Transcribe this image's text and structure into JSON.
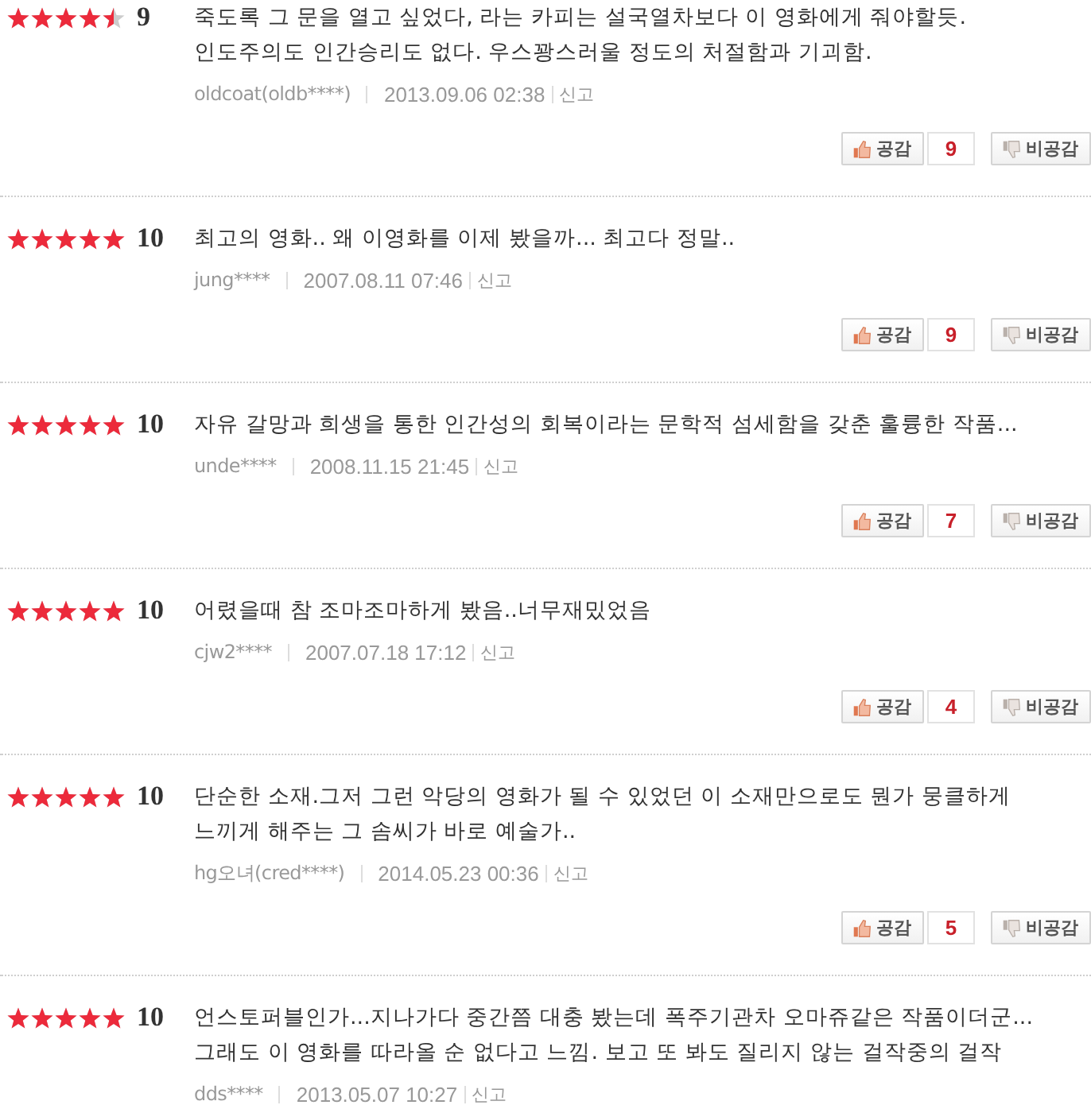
{
  "reviews": [
    {
      "stars": 4.5,
      "score": "9",
      "text": "죽도록 그 문을 열고 싶었다, 라는 카피는 설국열차보다 이 영화에게 줘야할듯. 인도주의도 인간승리도 없다. 우스꽝스러울 정도의 처절함과 기괴함.",
      "user": "oldcoat(oldb****)",
      "date": "2013.09.06 02:38",
      "report": "신고",
      "like_label": "공감",
      "like_count": "9",
      "dislike_label": "비공감"
    },
    {
      "stars": 5,
      "score": "10",
      "text": "최고의 영화.. 왜 이영화를 이제 봤을까... 최고다 정말..",
      "user": "jung****",
      "date": "2007.08.11 07:46",
      "report": "신고",
      "like_label": "공감",
      "like_count": "9",
      "dislike_label": "비공감"
    },
    {
      "stars": 5,
      "score": "10",
      "text": "자유 갈망과 희생을 통한 인간성의 회복이라는 문학적 섬세함을 갖춘 훌륭한 작품...",
      "user": "unde****",
      "date": "2008.11.15 21:45",
      "report": "신고",
      "like_label": "공감",
      "like_count": "7",
      "dislike_label": "비공감"
    },
    {
      "stars": 5,
      "score": "10",
      "text": "어렸을때 참 조마조마하게 봤음..너무재밌었음",
      "user": "cjw2****",
      "date": "2007.07.18 17:12",
      "report": "신고",
      "like_label": "공감",
      "like_count": "4",
      "dislike_label": "비공감"
    },
    {
      "stars": 5,
      "score": "10",
      "text": "단순한 소재.그저 그런 악당의 영화가 될 수 있었던 이 소재만으로도 뭔가 뭉클하게 느끼게 해주는 그 솜씨가 바로 예술가..",
      "user": "hg오녀(cred****)",
      "date": "2014.05.23 00:36",
      "report": "신고",
      "like_label": "공감",
      "like_count": "5",
      "dislike_label": "비공감"
    },
    {
      "stars": 5,
      "score": "10",
      "text": "언스토퍼블인가...지나가다 중간쯤 대충 봤는데 폭주기관차 오마쥬같은 작품이더군... 그래도 이 영화를 따라올 순 없다고 느낌. 보고 또 봐도 질리지 않는 걸작중의 걸작",
      "user": "dds****",
      "date": "2013.05.07 10:27",
      "report": "신고"
    }
  ]
}
